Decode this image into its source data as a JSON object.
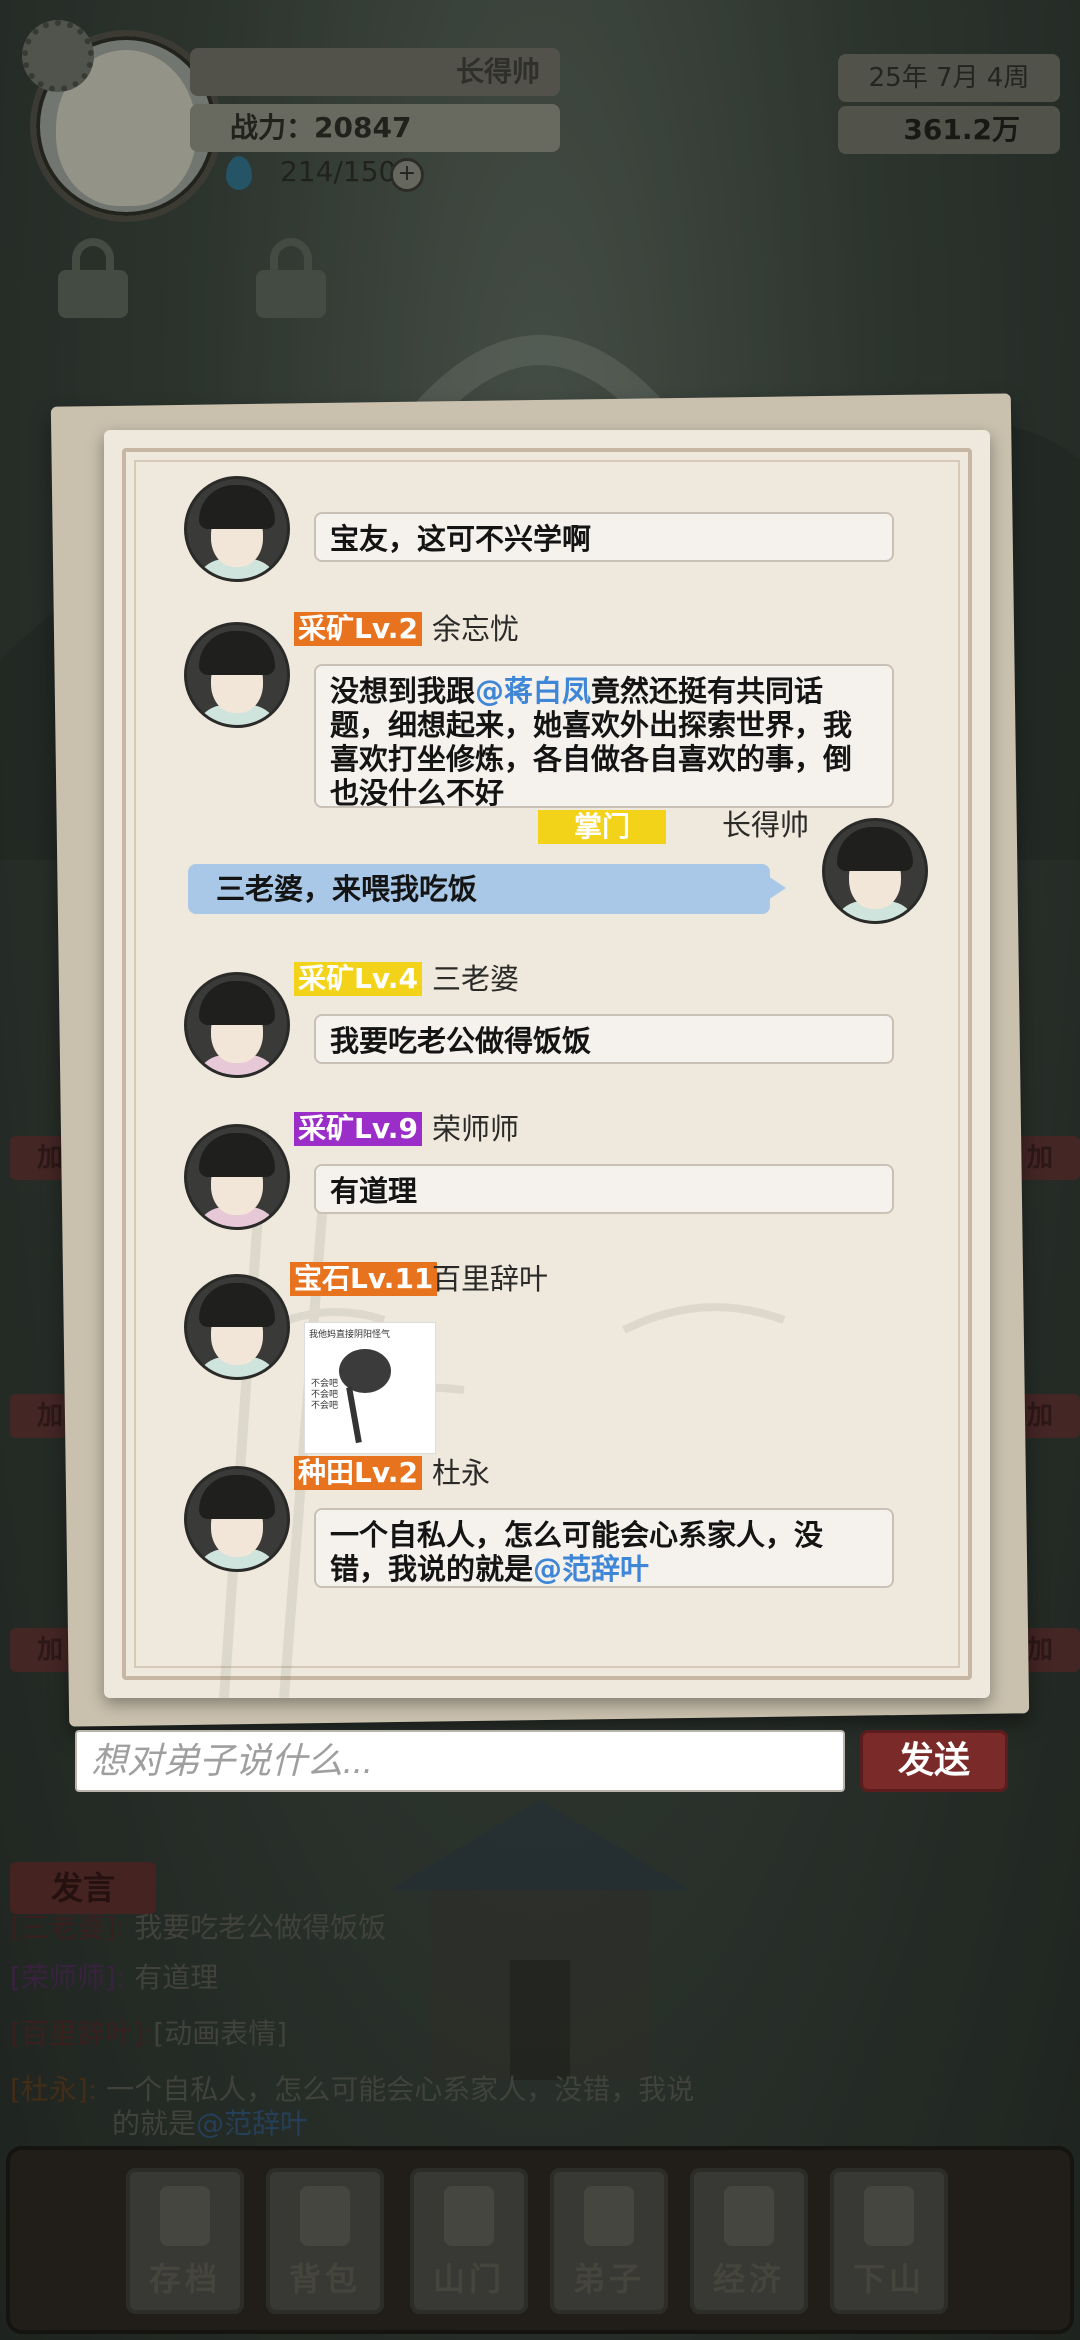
{
  "hud": {
    "player_name": "长得帅",
    "power_label": "战力：",
    "power_value": "20847",
    "stamina": "214/150",
    "plus_icon": "+",
    "date": "25年  7月  4周",
    "money": "361.2万"
  },
  "side_buttons": {
    "left": [
      "加",
      "加",
      "加"
    ],
    "right": [
      "加",
      "加",
      "加"
    ]
  },
  "chat": {
    "messages": [
      {
        "text": "宝友，这可不兴学啊"
      },
      {
        "tag": "采矿Lv.2",
        "tag_color": "#e8731f",
        "sender": "余忘忧",
        "text_pre": "没想到我跟",
        "mention": "@蒋白凤",
        "text_post": "竟然还挺有共同话题，细想起来，她喜欢外出探索世界，我喜欢打坐修炼，各自做各自喜欢的事，倒也没什么不好"
      },
      {
        "mine": true,
        "tag": "掌门",
        "tag_color": "#f3d21a",
        "sender": "长得帅",
        "text": "三老婆，来喂我吃饭"
      },
      {
        "tag": "采矿Lv.4",
        "tag_color": "#f3d21a",
        "sender": "三老婆",
        "text": "我要吃老公做得饭饭"
      },
      {
        "tag": "采矿Lv.9",
        "tag_color": "#9b2ec8",
        "sender": "荣师师",
        "text": "有道理"
      },
      {
        "tag": "宝石Lv.11",
        "tag_color": "#e8731f",
        "sender": "百里辞叶",
        "sticker_caption": "我他妈直接阴阳怪气",
        "sticker_sub": "不会吧 不会吧 不会吧"
      },
      {
        "tag": "种田Lv.2",
        "tag_color": "#e8731f",
        "sender": "杜永",
        "text_pre": "一个自私人，怎么可能会心系家人，没错，我说的就是",
        "mention": "@范辞叶"
      }
    ]
  },
  "input": {
    "placeholder": "想对弟子说什么...",
    "send_label": "发送"
  },
  "world_chat": {
    "speak_label": "发言",
    "lines": [
      {
        "name": "[三老婆]:",
        "text": "我要吃老公做得饭饭"
      },
      {
        "name": "[荣师师]:",
        "text": "有道理"
      },
      {
        "name": "[百里辞叶]:",
        "text": "[动画表情]"
      },
      {
        "name": "[杜永]:",
        "text": "一个自私人，怎么可能会心系家人，没错，我说",
        "cont": "的就是",
        "mention": "@范辞叶"
      }
    ]
  },
  "nav": [
    "存档",
    "背包",
    "山门",
    "弟子",
    "经济",
    "下山"
  ]
}
